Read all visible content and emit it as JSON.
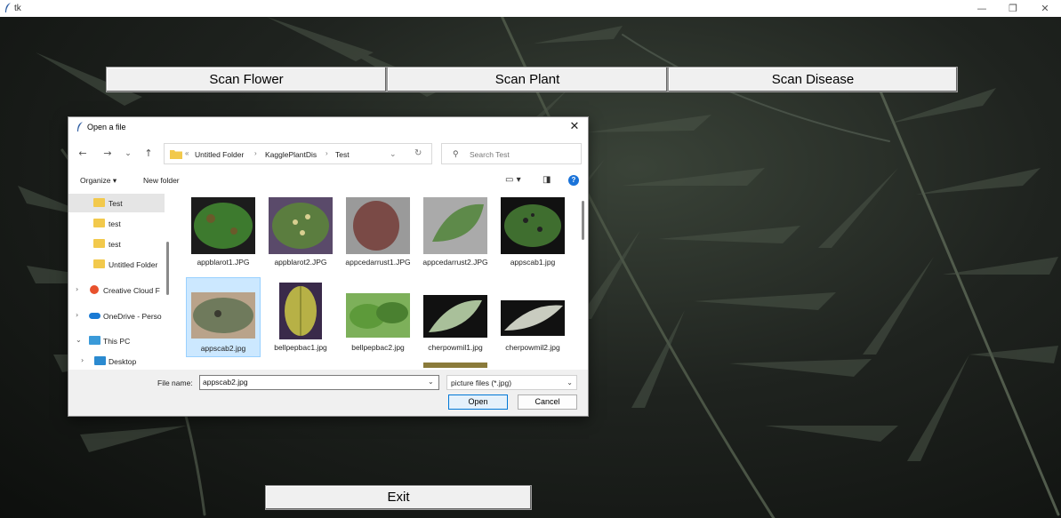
{
  "window": {
    "title": "tk",
    "minimize": "—",
    "restore": "❐",
    "close": "✕"
  },
  "buttons": {
    "scan_flower": "Scan Flower",
    "scan_plant": "Scan Plant",
    "scan_disease": "Scan Disease",
    "exit": "Exit"
  },
  "dialog": {
    "title": "Open a file",
    "close": "✕",
    "nav": {
      "back": "←",
      "forward": "→",
      "recent": "⌄",
      "up": "↑"
    },
    "breadcrumb": {
      "overflow": "«",
      "items": [
        "Untitled Folder",
        "KagglePlantDis",
        "Test"
      ],
      "separator": "›"
    },
    "search": {
      "placeholder": "Search Test",
      "icon": "⚲"
    },
    "toolbar": {
      "organize": "Organize ▾",
      "new_folder": "New folder",
      "help": "?"
    },
    "nav_pane": [
      {
        "label": "Test",
        "selected": true
      },
      {
        "label": "test"
      },
      {
        "label": "test"
      },
      {
        "label": "Untitled Folder"
      },
      {
        "label": "Creative Cloud F"
      },
      {
        "label": "OneDrive - Perso"
      },
      {
        "label": "This PC"
      },
      {
        "label": "Desktop"
      }
    ],
    "files": [
      {
        "name": "appblarot1.JPG",
        "color": "#3d7a2e"
      },
      {
        "name": "appblarot2.JPG",
        "color": "#5b7d3f"
      },
      {
        "name": "appcedarrust1.JPG",
        "color": "#7a4a46"
      },
      {
        "name": "appcedarrust2.JPG",
        "color": "#5e8a4a"
      },
      {
        "name": "appscab1.jpg",
        "color": "#3f6e2f"
      },
      {
        "name": "appscab2.jpg",
        "color": "#7f8a6a",
        "selected": true
      },
      {
        "name": "bellpepbac1.jpg",
        "color": "#b7b146"
      },
      {
        "name": "bellpepbac2.jpg",
        "color": "#5d9a3a"
      },
      {
        "name": "cherpowmil1.jpg",
        "color": "#a9c09a"
      },
      {
        "name": "cherpowmil2.jpg",
        "color": "#c9ccc0"
      }
    ],
    "filename_label": "File name:",
    "filename_value": "appscab2.jpg",
    "filter": "picture files (*.jpg)",
    "open": "Open",
    "cancel": "Cancel"
  }
}
